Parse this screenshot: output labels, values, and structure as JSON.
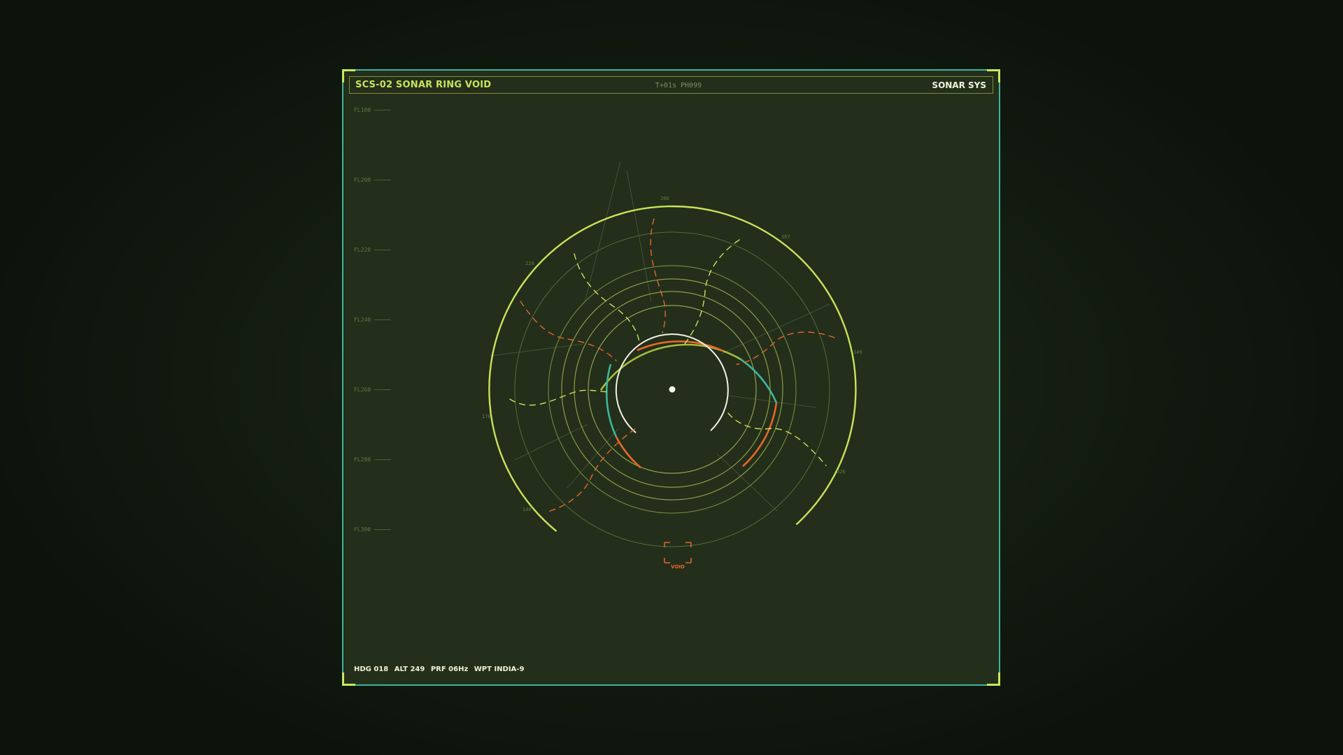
{
  "header": {
    "title": "SCS-02  SONAR RING VOID",
    "timestamp": "T+01s PH099",
    "system": "SONAR SYS"
  },
  "flight_levels": [
    "FL180",
    "FL200",
    "FL220",
    "FL240",
    "FL260",
    "FL280",
    "FL300"
  ],
  "bearing_labels": [
    "266",
    "307",
    "349",
    "026",
    "140",
    "178",
    "220"
  ],
  "target_marker": {
    "label": "VOID"
  },
  "status": {
    "heading": "HDG 018",
    "altitude": "ALT 249",
    "prf": "PRF 06Hz",
    "waypoint": "WPT INDIA-9"
  },
  "colors": {
    "frame_border": "#3fb59a",
    "corner_accent": "#cce85a",
    "ring_primary": "#c9e35b",
    "ring_alert": "#e8672a",
    "ring_sector": "#3fb59a",
    "inner_ring": "#f2f2e6",
    "panel_background": "#232f1b"
  }
}
